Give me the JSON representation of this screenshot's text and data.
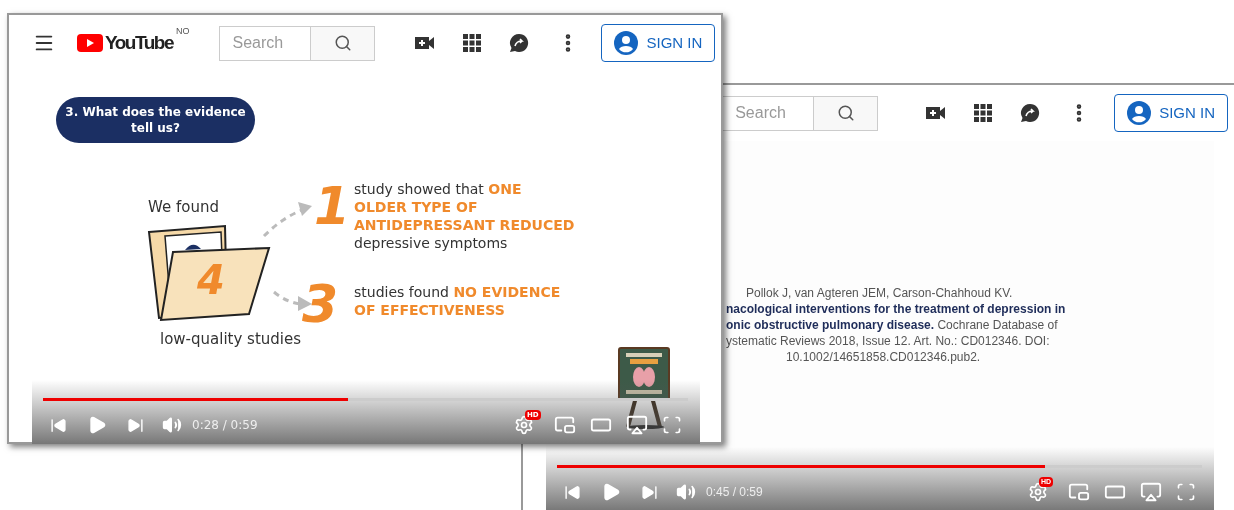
{
  "back_window": {
    "header": {
      "search": {
        "placeholder": "Search"
      },
      "sign_in": "SIGN IN"
    },
    "video": {
      "citation": [
        "Pollok  J, van Agteren  JEM, Carson-Chahhoud  KV.",
        "**nacological interventions for the treatment of depression in**",
        "**onic obstructive pulmonary disease.** Cochrane Database of",
        "ystematic Reviews 2018, Issue 12. Art. No.: CD012346. DOI:",
        "10.1002/14651858.CD012346.pub2."
      ],
      "progress": {
        "level": 0.756
      },
      "time": "0:45 / 0:59",
      "hd_badge": "HD"
    }
  },
  "front_window": {
    "header": {
      "logo": "YouTube",
      "country": "NO",
      "search": {
        "placeholder": "Search"
      },
      "sign_in": "SIGN IN"
    },
    "video": {
      "heading": [
        "3. What does the evidence",
        "tell us?"
      ],
      "intro": "We found",
      "folder_count": "4",
      "caption": "low-quality studies",
      "findings": [
        {
          "number": "1",
          "lines": [
            "study showed that **ONE**",
            "**OLDER TYPE OF**",
            "**ANTIDEPRESSANT REDUCED**",
            "depressive symptoms"
          ]
        },
        {
          "number": "3",
          "lines": [
            "studies found **NO EVIDENCE**",
            "**OF EFFECTIVENESS**"
          ]
        }
      ],
      "progress": {
        "level": 0.473
      },
      "time": "0:28 / 0:59",
      "hd_badge": "HD"
    }
  }
}
